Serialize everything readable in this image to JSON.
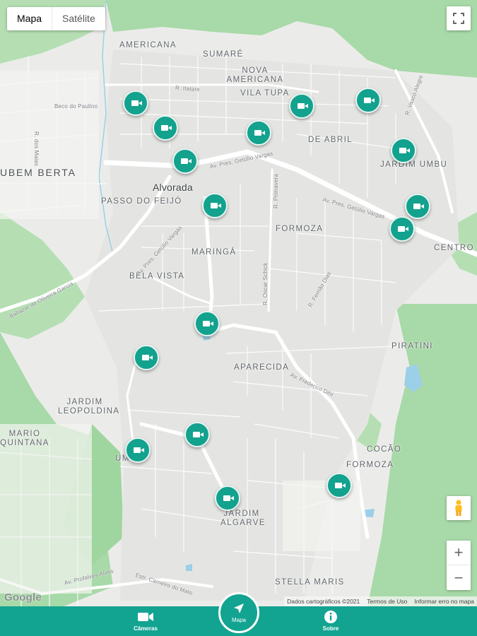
{
  "map_type": {
    "map_label": "Mapa",
    "satellite_label": "Satélite"
  },
  "labels": {
    "americana": "AMERICANA",
    "sumare": "SUMARÉ",
    "nova_americana": "NOVA AMERICANA",
    "vila_tupa": "VILA TUPA",
    "de_abril": "DE ABRIL",
    "jardim_umbu": "JARDIM UMBU",
    "rubem_berta": "UBEM BERTA",
    "alvorada": "Alvorada",
    "passo_do_feijo": "PASSO DO FEIJÓ",
    "formoza": "FORMOZA",
    "maringa": "MARINGÁ",
    "centro": "CENTRO",
    "bela_vista": "BELA VISTA",
    "piratini": "PIRATINI",
    "aparecida": "APARECIDA",
    "jardim_leopoldina": "JARDIM LEOPOLDINA",
    "mario_quintana": "MARIO QUINTANA",
    "umb": "UMB",
    "cocao": "COCÃO",
    "formoza_2": "FORMOZA",
    "jardim_algarve": "JARDIM ALGARVE",
    "stella_maris": "STELLA MARIS"
  },
  "streets": {
    "itatare": "R. Itatare",
    "beco": "Beco do Paulino",
    "dos_maias": "R. dos Maias",
    "getulio": "Av. Pres. Getúlio Vargas",
    "getulio_2": "Av. Pres. Getúlio Vargas",
    "getulio_3": "Av. Pres. Getúlio Vargas",
    "primavera": "R. Primavera",
    "oscar": "R. Oscar Schick",
    "fernao": "R. Fernão Dias",
    "baltazar": "Baltazar de Oliveira Garcia",
    "frederico": "Av. Frederico Dihl",
    "vasco": "R. Vasco Alegre",
    "profalves": "Av. Profalves Alves",
    "carneiro": "Estr. Carneiro do Mato"
  },
  "cameras": [
    {
      "id": "cam-1"
    },
    {
      "id": "cam-2"
    },
    {
      "id": "cam-3"
    },
    {
      "id": "cam-4"
    },
    {
      "id": "cam-5"
    },
    {
      "id": "cam-6"
    },
    {
      "id": "cam-7"
    },
    {
      "id": "cam-8"
    },
    {
      "id": "cam-9"
    },
    {
      "id": "cam-10"
    },
    {
      "id": "cam-11"
    },
    {
      "id": "cam-12"
    },
    {
      "id": "cam-13"
    },
    {
      "id": "cam-14"
    },
    {
      "id": "cam-15"
    },
    {
      "id": "cam-16"
    },
    {
      "id": "cam-17"
    }
  ],
  "attribution": {
    "data": "Dados cartográficos ©2021",
    "terms": "Termos de Uso",
    "report": "Informar erro no mapa"
  },
  "google": "Google",
  "controls": {
    "zoom_in": "+",
    "zoom_out": "−"
  },
  "nav": {
    "cameras_label": "Câmeras",
    "map_label": "Mapa",
    "about_label": "Sobre"
  },
  "colors": {
    "accent": "#13a391",
    "park": "#a8d9a8",
    "road": "#ffffff",
    "water": "#9ccfe8"
  }
}
